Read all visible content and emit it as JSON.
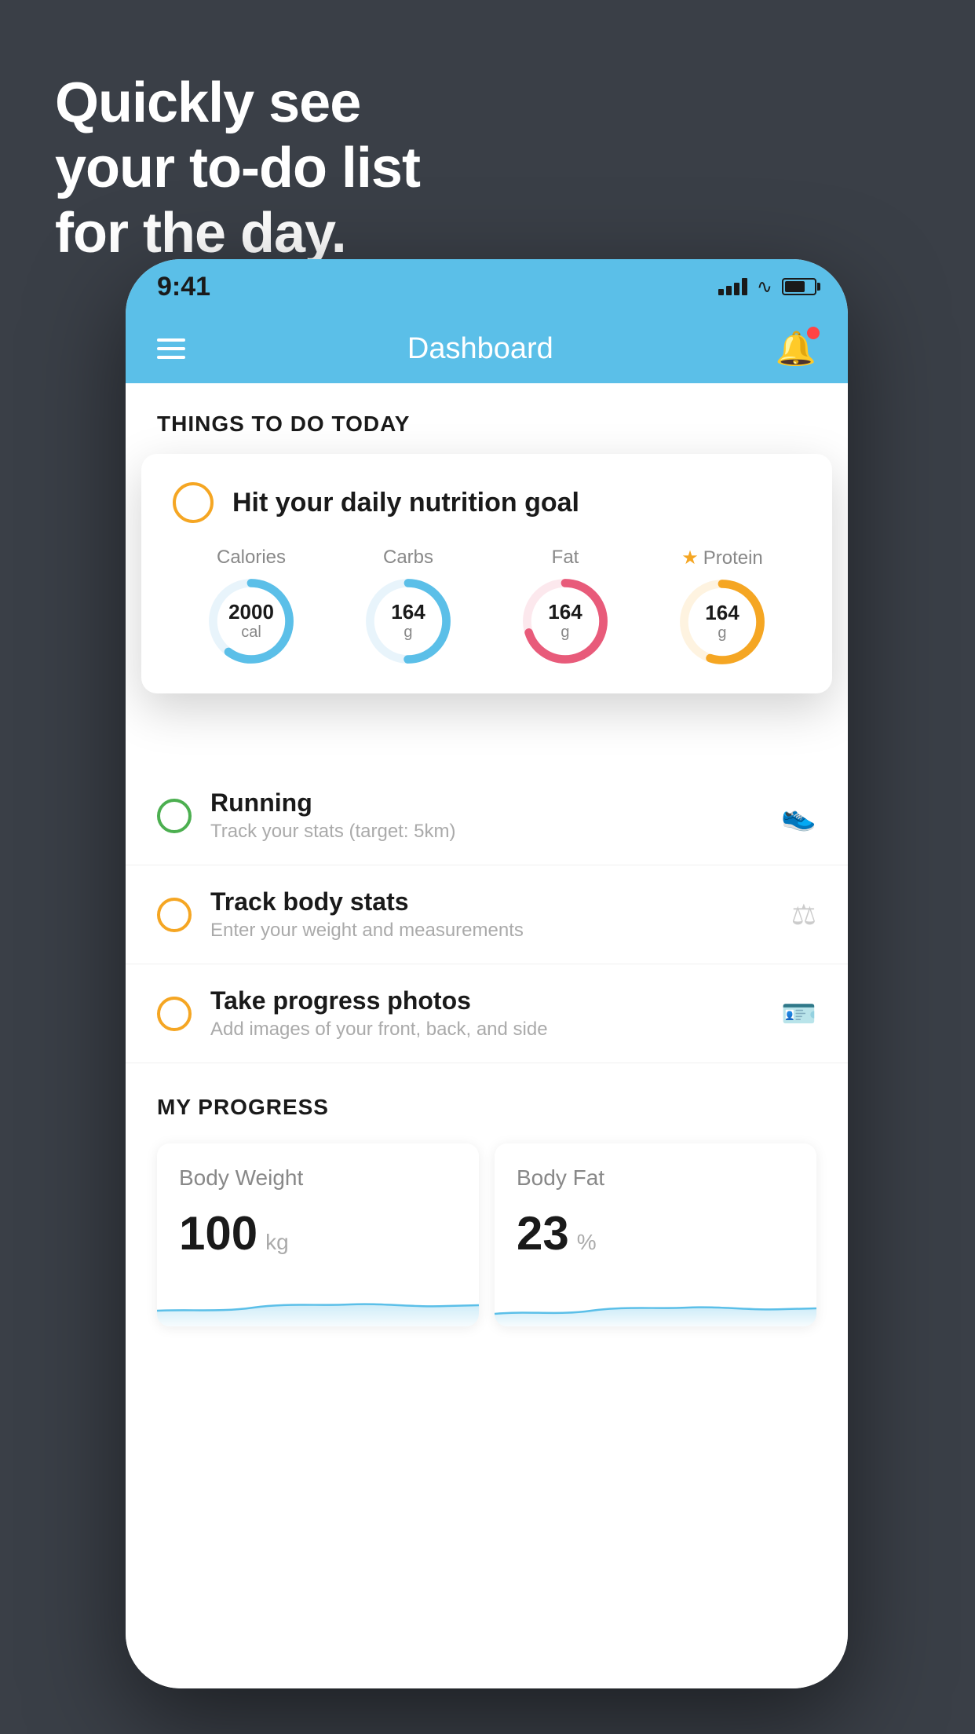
{
  "hero": {
    "line1": "Quickly see",
    "line2": "your to-do list",
    "line3": "for the day."
  },
  "status_bar": {
    "time": "9:41"
  },
  "header": {
    "title": "Dashboard"
  },
  "things_to_do": {
    "section_label": "THINGS TO DO TODAY",
    "nutrition_card": {
      "title": "Hit your daily nutrition goal",
      "circles": [
        {
          "label": "Calories",
          "value": "2000",
          "unit": "cal",
          "color": "#5bbfe8",
          "progress": 0.6
        },
        {
          "label": "Carbs",
          "value": "164",
          "unit": "g",
          "color": "#5bbfe8",
          "progress": 0.5
        },
        {
          "label": "Fat",
          "value": "164",
          "unit": "g",
          "color": "#e85b7a",
          "progress": 0.7
        },
        {
          "label": "Protein",
          "value": "164",
          "unit": "g",
          "color": "#f5a623",
          "progress": 0.55,
          "starred": true
        }
      ]
    },
    "items": [
      {
        "id": "running",
        "title": "Running",
        "subtitle": "Track your stats (target: 5km)",
        "circle_color": "green",
        "icon": "👟"
      },
      {
        "id": "body-stats",
        "title": "Track body stats",
        "subtitle": "Enter your weight and measurements",
        "circle_color": "yellow",
        "icon": "⚖"
      },
      {
        "id": "progress-photos",
        "title": "Take progress photos",
        "subtitle": "Add images of your front, back, and side",
        "circle_color": "yellow",
        "icon": "🪪"
      }
    ]
  },
  "my_progress": {
    "section_label": "MY PROGRESS",
    "cards": [
      {
        "title": "Body Weight",
        "value": "100",
        "unit": "kg"
      },
      {
        "title": "Body Fat",
        "value": "23",
        "unit": "%"
      }
    ]
  }
}
